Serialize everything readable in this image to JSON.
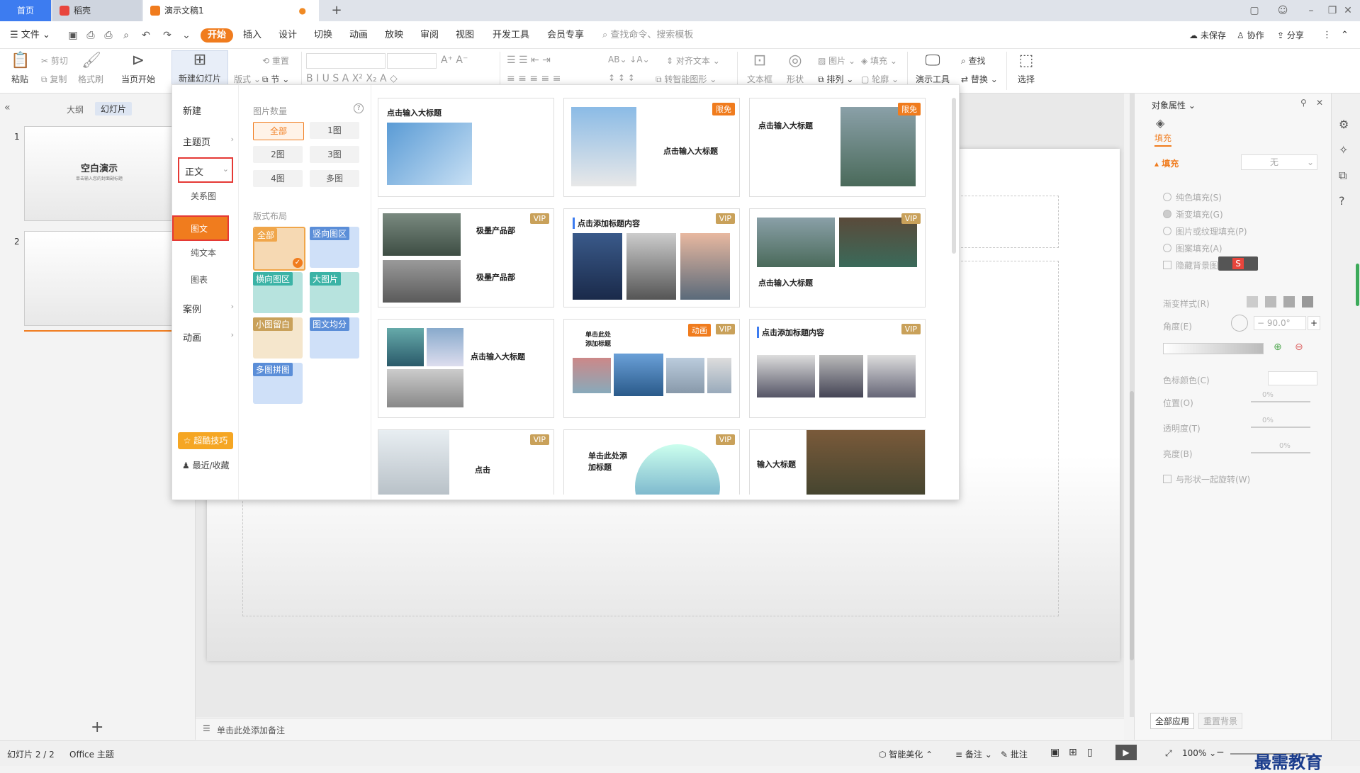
{
  "tabs": {
    "home": "首页",
    "daoke": "稻壳",
    "doc": "演示文稿1"
  },
  "menu": {
    "file": "文件",
    "items": [
      "开始",
      "插入",
      "设计",
      "切换",
      "动画",
      "放映",
      "审阅",
      "视图",
      "开发工具",
      "会员专享"
    ],
    "search_placeholder": "查找命令、搜索模板",
    "unsaved": "未保存",
    "collab": "协作",
    "share": "分享"
  },
  "ribbon": {
    "paste": "粘贴",
    "cut": "剪切",
    "copy": "复制",
    "format_painter": "格式刷",
    "from_current": "当页开始",
    "new_slide": "新建幻灯片",
    "layout": "版式",
    "section": "节",
    "reset": "重置",
    "align_text": "对齐文本",
    "smart_graphic": "转智能图形",
    "textbox": "文本框",
    "shape": "形状",
    "picture": "图片",
    "fill": "填充",
    "arrange": "排列",
    "outline": "轮廓",
    "present_tools": "演示工具",
    "find": "查找",
    "replace": "替换",
    "select": "选择"
  },
  "left_panel": {
    "outline_tab": "大纲",
    "slides_tab": "幻灯片",
    "slide1_num": "1",
    "slide1_title": "空白演示",
    "slide1_sub": "单击输入您的封面副标题",
    "slide2_num": "2"
  },
  "notes": "单击此处添加备注",
  "dropdown": {
    "nav": {
      "new": "新建",
      "theme": "主题页",
      "body": "正文",
      "relation": "关系图",
      "picture_text": "图文",
      "plain_text": "纯文本",
      "chart": "图表",
      "case": "案例",
      "animation": "动画",
      "tips": "超酷技巧",
      "recent": "最近/收藏"
    },
    "filter": {
      "count_label": "图片数量",
      "counts": [
        "全部",
        "1图",
        "2图",
        "3图",
        "4图",
        "多图"
      ],
      "layout_label": "版式布局",
      "layouts": [
        "全部",
        "竖向图区",
        "横向图区",
        "大图片",
        "小图留白",
        "图文均分",
        "多图拼图"
      ]
    },
    "cards": [
      {
        "title": "点击输入大标题",
        "badge": ""
      },
      {
        "title": "点击输入大标题",
        "badge": "限免"
      },
      {
        "title": "点击输入大标题",
        "badge": "限免"
      },
      {
        "title": "极墨产品部",
        "badge": "VIP"
      },
      {
        "title": "点击添加标题内容",
        "badge": "VIP"
      },
      {
        "title": "点击输入大标题",
        "badge": "VIP"
      },
      {
        "title": "点击输入大标题",
        "badge": ""
      },
      {
        "title": "单击此处添加标题",
        "badge": "VIP",
        "badge2": "动画"
      },
      {
        "title": "点击添加标题内容",
        "badge": "VIP"
      },
      {
        "title": "点击",
        "badge": "VIP"
      },
      {
        "title": "单击此处添加标题",
        "badge": "VIP"
      },
      {
        "title": "输入大标题",
        "badge": ""
      }
    ]
  },
  "right_panel": {
    "title": "对象属性",
    "fill_tab": "填充",
    "fill_section": "填充",
    "fill_value": "无",
    "options": [
      "纯色填充(S)",
      "渐变填充(G)",
      "图片或纹理填充(P)",
      "图案填充(A)"
    ],
    "hide_bg": "隐藏背景图",
    "gradient_style": "渐变样式(R)",
    "angle": "角度(E)",
    "angle_value": "90.0°",
    "stop_color": "色标颜色(C)",
    "position": "位置(O)",
    "transparency": "透明度(T)",
    "brightness": "亮度(B)",
    "rotate_with": "与形状一起旋转(W)",
    "pct": "0%",
    "apply_all": "全部应用",
    "reset_bg": "重置背景"
  },
  "status": {
    "slide_count": "幻灯片 2 / 2",
    "theme": "Office 主题",
    "smart": "智能美化",
    "notes_btn": "备注",
    "comment": "批注",
    "zoom": "100%"
  },
  "watermark": "最需教育",
  "colors": {
    "accent": "#f07c1e",
    "blue": "#3d7cf0",
    "vip": "#c9a15a",
    "free": "#f07c1e",
    "red_outline": "#e53935"
  }
}
